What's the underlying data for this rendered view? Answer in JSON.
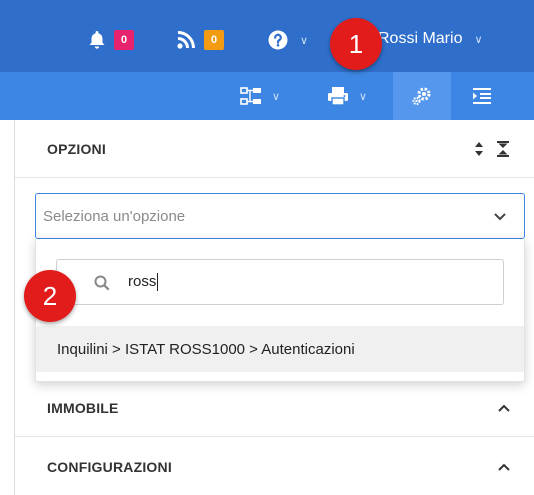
{
  "topbar": {
    "notifications": {
      "icon": "bell-icon",
      "count": "0",
      "color": "#e8236d"
    },
    "feed": {
      "icon": "rss-icon",
      "count": "0",
      "color": "#f39c12"
    },
    "help": {
      "icon": "question-circle-icon",
      "caret": "∨"
    },
    "user": {
      "icon": "user-icon",
      "name": "Rossi Mario",
      "caret": "∨"
    }
  },
  "subbar": {
    "buttons": [
      {
        "icon": "sitemap-icon",
        "caret": "∨"
      },
      {
        "icon": "print-icon",
        "caret": "∨"
      },
      {
        "icon": "gears-icon",
        "active": true
      },
      {
        "icon": "indent-list-icon"
      }
    ]
  },
  "markers": {
    "first": "1",
    "second": "2"
  },
  "panel": {
    "options_title": "OPZIONI",
    "select_placeholder": "Seleziona un'opzione",
    "search_value": "ross",
    "result_option": "Inquilini > ISTAT ROSS1000 > Autenticazioni",
    "sections": [
      {
        "title": "IMMOBILE"
      },
      {
        "title": "CONFIGURAZIONI"
      }
    ]
  },
  "colors": {
    "topbar": "#2f6fcb",
    "subbar": "#3d86e3",
    "accent": "#3d86e3",
    "marker": "#e21b1b"
  }
}
